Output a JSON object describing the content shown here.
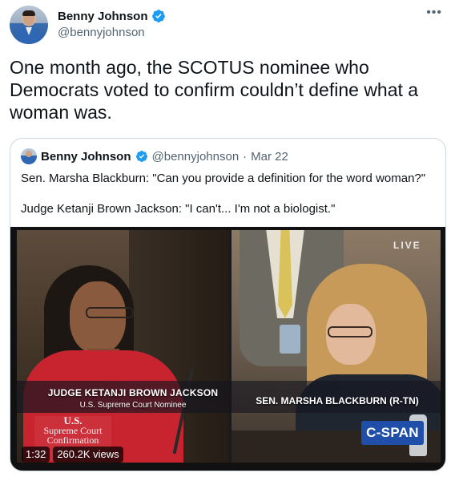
{
  "author": {
    "display_name": "Benny Johnson",
    "handle": "@bennyjohnson",
    "verified": true
  },
  "menu_icon": "more-horizontal-icon",
  "tweet_text": "One month ago, the SCOTUS nominee who Democrats voted to confirm couldn’t define what a woman was.",
  "quoted_tweet": {
    "display_name": "Benny Johnson",
    "handle": "@bennyjohnson",
    "separator": "·",
    "date": "Mar 22",
    "lines": [
      "Sen. Marsha Blackburn: \"Can you provide a definition for the word woman?\"",
      "Judge Ketanji Brown Jackson: \"I can't... I'm not a biologist.\""
    ]
  },
  "video": {
    "live_label": "LIVE",
    "left_caption_name": "JUDGE KETANJI BROWN JACKSON",
    "left_caption_title": "U.S. Supreme Court Nominee",
    "right_caption_name": "SEN. MARSHA BLACKBURN (R-TN)",
    "seal_lines": [
      "U.S.",
      "Supreme Court",
      "Confirmation"
    ],
    "network_logo": "C-SPAN",
    "duration": "1:32",
    "views": "260.2K views"
  },
  "colors": {
    "verified": "#1d9bf0",
    "text": "#0f1419",
    "secondary": "#536471",
    "border": "#cfd9de",
    "cspan": "#1f4fa8"
  }
}
